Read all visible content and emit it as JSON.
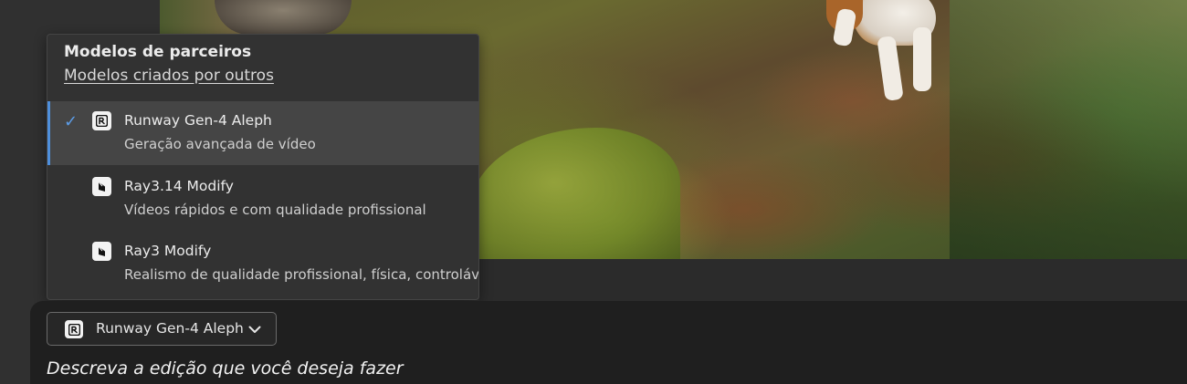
{
  "model_menu": {
    "section_title": "Modelos de parceiros",
    "section_link": "Modelos criados por outros",
    "items": [
      {
        "name": "Runway Gen-4 Aleph",
        "description": "Geração avançada de vídeo",
        "selected": true,
        "icon": "runway-logo-icon"
      },
      {
        "name": "Ray3.14 Modify",
        "description": "Vídeos rápidos e com qualidade profissional",
        "selected": false,
        "icon": "luma-logo-icon"
      },
      {
        "name": "Ray3 Modify",
        "description": "Realismo de qualidade profissional, física, controlável",
        "selected": false,
        "icon": "luma-logo-icon"
      }
    ],
    "check_glyph": "✓"
  },
  "model_select": {
    "label": "Runway Gen-4 Aleph",
    "icon": "runway-logo-icon",
    "chevron": "chevron-down-icon"
  },
  "prompt": {
    "placeholder": "Descreva a edição que você deseja fazer"
  },
  "colors": {
    "accent": "#5c9ce6",
    "menu_bg": "#323232",
    "selected_bg": "#454545",
    "panel_bg": "#1f1f1f"
  }
}
